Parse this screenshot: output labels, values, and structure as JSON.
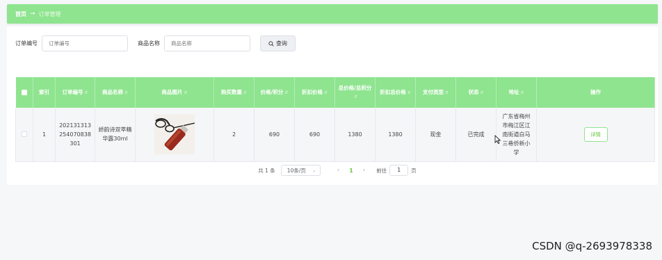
{
  "breadcrumb": {
    "home": "首页",
    "separator": "→",
    "current": "订单管理"
  },
  "search": {
    "order_no_label": "订单编号",
    "order_no_placeholder": "订单编号",
    "product_name_label": "商品名称",
    "product_name_placeholder": "商品名称",
    "query_button": "查询"
  },
  "table": {
    "columns": [
      "索引",
      "订单编号",
      "商品名称",
      "商品图片",
      "购买数量",
      "价格/积分",
      "折扣价格",
      "总价格/总积分",
      "折扣总价格",
      "支付类型",
      "状态",
      "地址",
      "操作"
    ],
    "rows": [
      {
        "index": "1",
        "order_no": "202131313254070838301",
        "product_name": "娇韵诗双萃精华露30ml",
        "quantity": "2",
        "price": "690",
        "discount_price": "690",
        "total_price": "1380",
        "discount_total": "1380",
        "pay_type": "现金",
        "status": "已完成",
        "address": "广东省梅州市梅江区江南街道白马三巷侨新小学",
        "action": "详情"
      }
    ]
  },
  "pagination": {
    "total": "共 1 条",
    "page_size": "10条/页",
    "current_page": "1",
    "goto_label": "前往",
    "goto_value": "1",
    "page_suffix": "页"
  },
  "watermark": "CSDN @q-2693978338",
  "colors": {
    "header_green": "#8fe48f",
    "accent_green": "#67c23a"
  }
}
